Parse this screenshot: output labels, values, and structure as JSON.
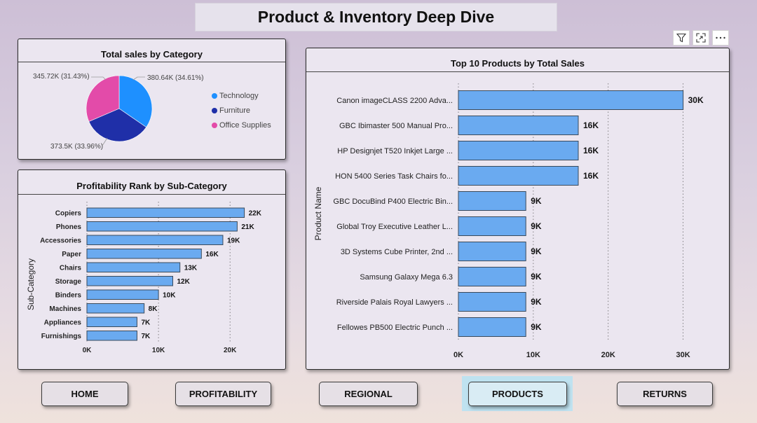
{
  "page_title": "Product & Inventory Deep Dive",
  "toolbar": {
    "icons": [
      "filter-icon",
      "focus-mode-icon",
      "more-options-icon"
    ]
  },
  "colors": {
    "bar": "#6aaaf0",
    "technology": "#1e90ff",
    "furniture": "#1f2fa8",
    "office_supplies": "#e34ba9"
  },
  "pie_card": {
    "title": "Total sales by Category",
    "labels": {
      "technology": "380.64K (34.61%)",
      "furniture": "373.5K (33.96%)",
      "office_supplies": "345.72K (31.43%)"
    },
    "legend": [
      "Technology",
      "Furniture",
      "Office Supplies"
    ]
  },
  "subcat_card": {
    "title": "Profitability Rank by Sub-Category",
    "axis_title": "Sub-Category"
  },
  "top10_card": {
    "title": "Top 10 Products by Total Sales",
    "axis_title": "Product Name"
  },
  "nav": [
    {
      "label": "HOME",
      "active": false
    },
    {
      "label": "PROFITABILITY",
      "active": false
    },
    {
      "label": "REGIONAL",
      "active": false
    },
    {
      "label": "PRODUCTS",
      "active": true
    },
    {
      "label": "RETURNS",
      "active": false
    }
  ],
  "chart_data": [
    {
      "type": "pie",
      "title": "Total sales by Category",
      "categories": [
        "Technology",
        "Furniture",
        "Office Supplies"
      ],
      "values": [
        380.64,
        373.5,
        345.72
      ],
      "value_unit": "K",
      "percent": [
        34.61,
        33.96,
        31.43
      ],
      "data_labels": [
        "380.64K (34.61%)",
        "373.5K (33.96%)",
        "345.72K (31.43%)"
      ],
      "legend": "right"
    },
    {
      "type": "bar",
      "orientation": "horizontal",
      "title": "Profitability Rank by Sub-Category",
      "ylabel": "Sub-Category",
      "categories": [
        "Copiers",
        "Phones",
        "Accessories",
        "Paper",
        "Chairs",
        "Storage",
        "Binders",
        "Machines",
        "Appliances",
        "Furnishings"
      ],
      "values": [
        22,
        21,
        19,
        16,
        13,
        12,
        10,
        8,
        7,
        7
      ],
      "value_unit": "K",
      "data_labels": [
        "22K",
        "21K",
        "19K",
        "16K",
        "13K",
        "12K",
        "10K",
        "8K",
        "7K",
        "7K"
      ],
      "xticks": [
        "0K",
        "10K",
        "20K"
      ],
      "xlim": [
        0,
        24
      ],
      "grid": "vertical dotted"
    },
    {
      "type": "bar",
      "orientation": "horizontal",
      "title": "Top 10 Products by Total Sales",
      "ylabel": "Product Name",
      "categories": [
        "Canon imageCLASS 2200 Adva...",
        "GBC Ibimaster 500 Manual Pro...",
        "HP Designjet T520 Inkjet Large ...",
        "HON 5400 Series Task Chairs fo...",
        "GBC DocuBind P400 Electric Bin...",
        "Global Troy Executive Leather L...",
        "3D Systems Cube Printer, 2nd ...",
        "Samsung Galaxy Mega 6.3",
        "Riverside Palais Royal Lawyers ...",
        "Fellowes PB500 Electric Punch ..."
      ],
      "values": [
        30,
        16,
        16,
        16,
        9,
        9,
        9,
        9,
        9,
        9
      ],
      "value_unit": "K",
      "data_labels": [
        "30K",
        "16K",
        "16K",
        "16K",
        "9K",
        "9K",
        "9K",
        "9K",
        "9K",
        "9K"
      ],
      "xticks": [
        "0K",
        "10K",
        "20K",
        "30K"
      ],
      "xlim": [
        0,
        32
      ],
      "grid": "vertical dotted"
    }
  ]
}
